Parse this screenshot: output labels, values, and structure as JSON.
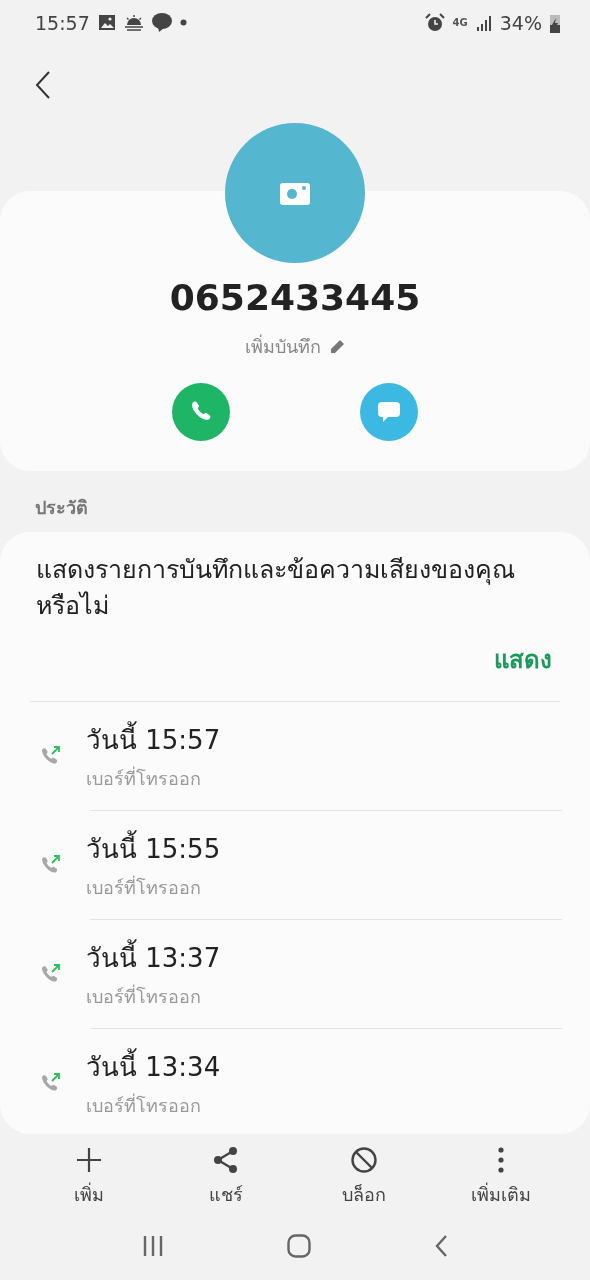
{
  "status_bar": {
    "time": "15:57",
    "network": "4G",
    "battery": "34%"
  },
  "contact": {
    "number": "0652433445",
    "note_placeholder": "เพิ่มบันทึก"
  },
  "history": {
    "title": "ประวัติ",
    "prompt": "แสดงรายการบันทึกและข้อความเสียงของคุณหรือไม่",
    "action": "แสดง",
    "calls": [
      {
        "time": "วันนี้ 15:57",
        "type": "เบอร์ที่โทรออก",
        "kind": "outgoing"
      },
      {
        "time": "วันนี้ 15:55",
        "type": "เบอร์ที่โทรออก",
        "kind": "outgoing"
      },
      {
        "time": "วันนี้ 13:37",
        "type": "เบอร์ที่โทรออก",
        "kind": "outgoing"
      },
      {
        "time": "วันนี้ 13:34",
        "type": "เบอร์ที่โทรออก",
        "kind": "outgoing"
      }
    ]
  },
  "actions": [
    {
      "label": "เพิ่ม",
      "kind": "add"
    },
    {
      "label": "แชร์",
      "kind": "share"
    },
    {
      "label": "บล็อก",
      "kind": "block"
    },
    {
      "label": "เพิ่มเติม",
      "kind": "more"
    }
  ]
}
